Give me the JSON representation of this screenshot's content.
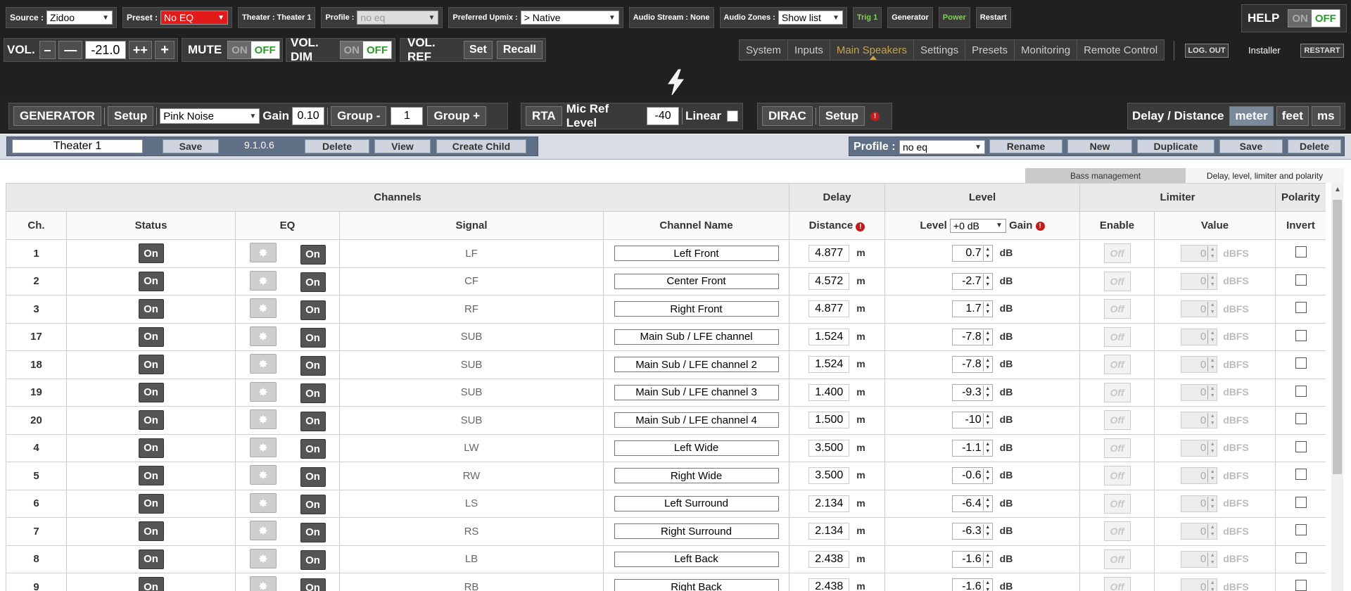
{
  "header": {
    "source": {
      "label": "Source :",
      "value": "Zidoo"
    },
    "preset": {
      "label": "Preset :",
      "value": "No EQ"
    },
    "theater": "Theater : Theater 1",
    "profile": {
      "label": "Profile :",
      "value": "no eq"
    },
    "upmix": {
      "label": "Preferred Upmix :",
      "value": "> Native"
    },
    "audio_stream": "Audio Stream : None",
    "audio_zones": {
      "label": "Audio Zones :",
      "value": "Show list"
    },
    "trig": "Trig 1",
    "generator": "Generator",
    "power": "Power",
    "restart": "Restart",
    "help": {
      "label": "HELP",
      "on": "ON",
      "off": "OFF"
    }
  },
  "volume": {
    "label": "VOL.",
    "minus": "–",
    "minus2": "—",
    "value": "-21.0",
    "plus2": "++",
    "plus": "+",
    "mute": {
      "label": "MUTE",
      "on": "ON",
      "off": "OFF"
    },
    "dim": {
      "label": "VOL. DIM",
      "on": "ON",
      "off": "OFF"
    },
    "ref": {
      "label": "VOL. REF",
      "set": "Set",
      "recall": "Recall"
    }
  },
  "nav": {
    "tabs": [
      "System",
      "Inputs",
      "Main Speakers",
      "Settings",
      "Presets",
      "Monitoring",
      "Remote Control"
    ],
    "active": "Main Speakers",
    "logout": "LOG. OUT",
    "installer": "Installer",
    "restart": "RESTART"
  },
  "generator_row": {
    "generator": "GENERATOR",
    "setup": "Setup",
    "signal": "Pink Noise",
    "gain_label": "Gain",
    "gain": "0.10",
    "group_minus": "Group -",
    "group": "1",
    "group_plus": "Group +",
    "rta": "RTA",
    "mic_ref_label": "Mic Ref Level",
    "mic_ref": "-40",
    "linear": "Linear",
    "dirac": "DIRAC",
    "dirac_setup": "Setup",
    "alert": "!",
    "delay_label": "Delay / Distance",
    "units": [
      "meter",
      "feet",
      "ms"
    ],
    "unit_selected": "meter"
  },
  "theater_bar": {
    "name": "Theater 1",
    "save": "Save",
    "version": "9.1.0.6",
    "delete": "Delete",
    "view": "View",
    "create_child": "Create Child"
  },
  "profile_bar": {
    "label": "Profile :",
    "value": "no eq",
    "rename": "Rename",
    "new": "New",
    "duplicate": "Duplicate",
    "save": "Save",
    "delete": "Delete"
  },
  "subtabs": {
    "bass": "Bass management",
    "delay": "Delay, level, limiter and polarity"
  },
  "table": {
    "groups": [
      "Channels",
      "Delay",
      "Level",
      "Limiter",
      "Polarity"
    ],
    "headers": {
      "ch": "Ch.",
      "status": "Status",
      "eq": "EQ",
      "signal": "Signal",
      "name": "Channel Name",
      "distance": "Distance",
      "level": "Level",
      "level_sel": "+0 dB",
      "gain": "Gain",
      "enable": "Enable",
      "value": "Value",
      "invert": "Invert"
    },
    "on": "On",
    "off": "Off",
    "dist_unit": "m",
    "lvl_unit": "dB",
    "lim_unit": "dBFS",
    "rows": [
      {
        "ch": "1",
        "signal": "LF",
        "name": "Left Front",
        "dist": "4.877",
        "level": "0.7",
        "limit": "0"
      },
      {
        "ch": "2",
        "signal": "CF",
        "name": "Center Front",
        "dist": "4.572",
        "level": "-2.7",
        "limit": "0"
      },
      {
        "ch": "3",
        "signal": "RF",
        "name": "Right Front",
        "dist": "4.877",
        "level": "1.7",
        "limit": "0"
      },
      {
        "ch": "17",
        "signal": "SUB",
        "name": "Main Sub / LFE channel",
        "dist": "1.524",
        "level": "-7.8",
        "limit": "0"
      },
      {
        "ch": "18",
        "signal": "SUB",
        "name": "Main Sub / LFE channel 2",
        "dist": "1.524",
        "level": "-7.8",
        "limit": "0"
      },
      {
        "ch": "19",
        "signal": "SUB",
        "name": "Main Sub / LFE channel 3",
        "dist": "1.400",
        "level": "-9.3",
        "limit": "0"
      },
      {
        "ch": "20",
        "signal": "SUB",
        "name": "Main Sub / LFE channel 4",
        "dist": "1.500",
        "level": "-10",
        "limit": "0"
      },
      {
        "ch": "4",
        "signal": "LW",
        "name": "Left Wide",
        "dist": "3.500",
        "level": "-1.1",
        "limit": "0"
      },
      {
        "ch": "5",
        "signal": "RW",
        "name": "Right Wide",
        "dist": "3.500",
        "level": "-0.6",
        "limit": "0"
      },
      {
        "ch": "6",
        "signal": "LS",
        "name": "Left Surround",
        "dist": "2.134",
        "level": "-6.4",
        "limit": "0"
      },
      {
        "ch": "7",
        "signal": "RS",
        "name": "Right Surround",
        "dist": "2.134",
        "level": "-6.3",
        "limit": "0"
      },
      {
        "ch": "8",
        "signal": "LB",
        "name": "Left Back",
        "dist": "2.438",
        "level": "-1.6",
        "limit": "0"
      },
      {
        "ch": "9",
        "signal": "RB",
        "name": "Right Back",
        "dist": "2.438",
        "level": "-1.6",
        "limit": "0"
      }
    ]
  }
}
